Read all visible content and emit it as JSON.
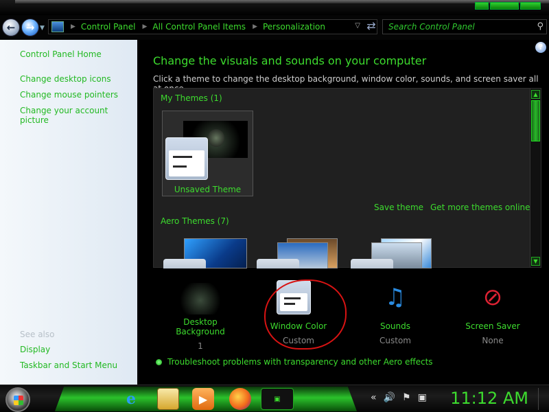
{
  "breadcrumb": [
    "Control Panel",
    "All Control Panel Items",
    "Personalization"
  ],
  "search": {
    "placeholder": "Search Control Panel"
  },
  "sidebar": {
    "links": [
      "Control Panel Home",
      "Change desktop icons",
      "Change mouse pointers",
      "Change your account picture"
    ],
    "see_also_label": "See also",
    "see_also_links": [
      "Display",
      "Taskbar and Start Menu"
    ]
  },
  "main": {
    "title": "Change the visuals and sounds on your computer",
    "subtitle": "Click a theme to change the desktop background, window color, sounds, and screen saver all at once.",
    "my_themes_heading": "My Themes (1)",
    "unsaved_theme_label": "Unsaved Theme",
    "save_theme_link": "Save theme",
    "more_themes_link": "Get more themes online",
    "aero_themes_heading": "Aero Themes (7)",
    "bottom_items": [
      {
        "name": "Desktop Background",
        "sub": "1"
      },
      {
        "name": "Window Color",
        "sub": "Custom"
      },
      {
        "name": "Sounds",
        "sub": "Custom"
      },
      {
        "name": "Screen Saver",
        "sub": "None"
      }
    ],
    "troubleshoot_link": "Troubleshoot problems with transparency and other Aero effects"
  },
  "taskbar": {
    "clock": "11:12 AM"
  },
  "colors": {
    "accent_green": "#3ddc2e",
    "annotation_red": "#d81313",
    "sidebar_bg": "#eaf1f8"
  }
}
